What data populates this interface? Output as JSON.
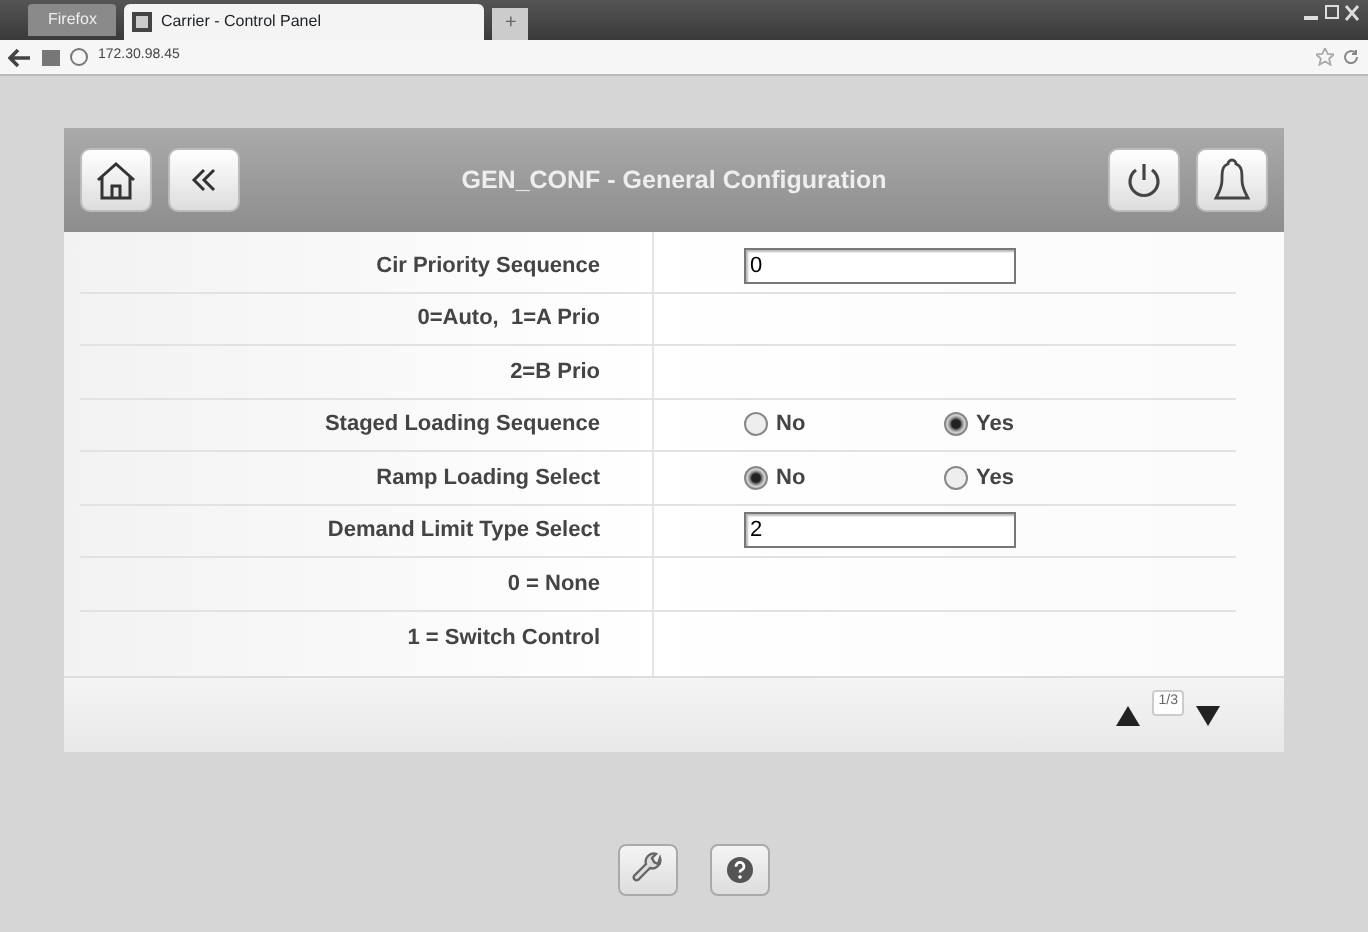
{
  "browser": {
    "menu_button": "Firefox",
    "tab_title": "Carrier - Control Panel",
    "new_tab": "+",
    "address": "172.30.98.45"
  },
  "header": {
    "title": "GEN_CONF - General Configuration"
  },
  "rows": [
    {
      "kind": "input",
      "label": "Cir Priority Sequence",
      "value": "0"
    },
    {
      "kind": "text",
      "label": "0=Auto,  1=A Prio"
    },
    {
      "kind": "text",
      "label": "2=B Prio"
    },
    {
      "kind": "radio",
      "label": "Staged Loading Sequence",
      "options": [
        {
          "label": "No",
          "selected": false
        },
        {
          "label": "Yes",
          "selected": true
        }
      ]
    },
    {
      "kind": "radio",
      "label": "Ramp Loading Select",
      "options": [
        {
          "label": "No",
          "selected": true
        },
        {
          "label": "Yes",
          "selected": false
        }
      ]
    },
    {
      "kind": "input",
      "label": "Demand Limit Type Select",
      "value": "2"
    },
    {
      "kind": "text",
      "label": "0 = None"
    },
    {
      "kind": "text",
      "label": "1 = Switch Control"
    }
  ],
  "pager": {
    "page": "1/3"
  }
}
